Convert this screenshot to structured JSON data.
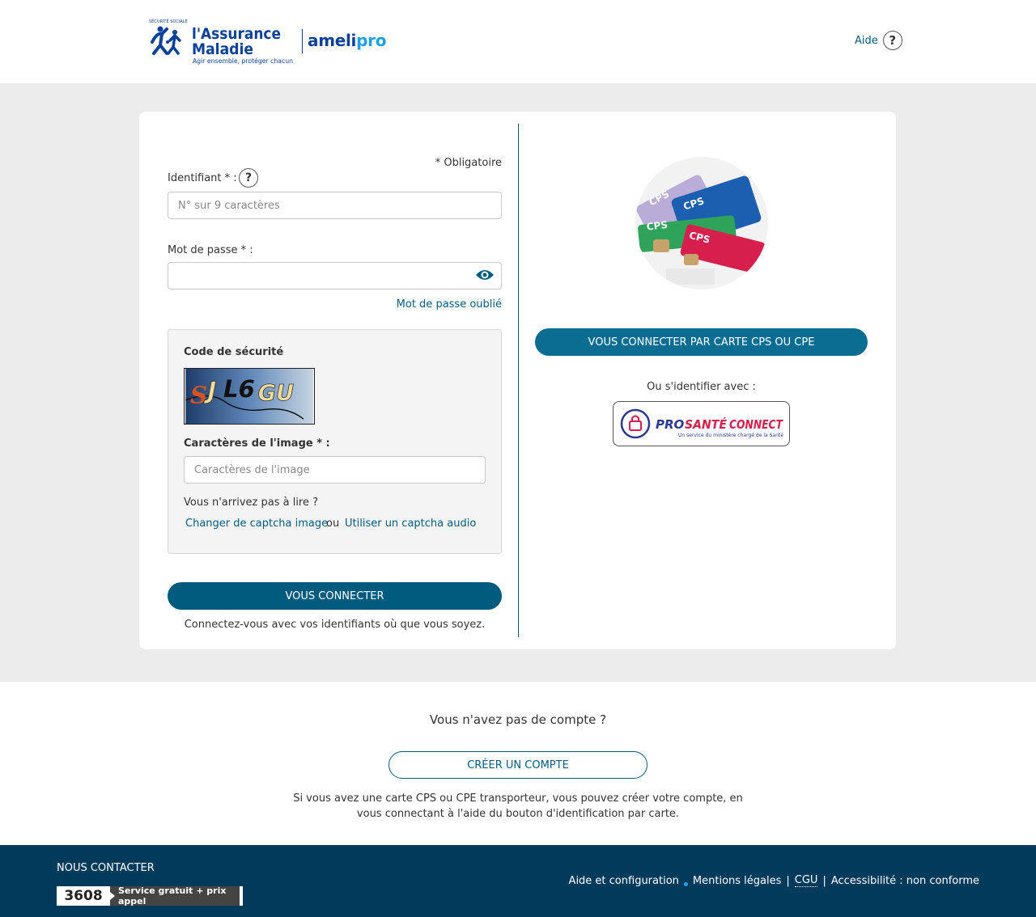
{
  "header": {
    "brand_name_line1": "l'Assurance",
    "brand_name_line2": "Maladie",
    "brand_tagline": "Agir ensemble, protéger chacun",
    "brand_arc_text": "SÉCURITÉ SOCIALE",
    "product_part1": "ameli",
    "product_part2": "pro",
    "help_label": "Aide",
    "help_icon": "question-circle-icon"
  },
  "login": {
    "required_note": "* Obligatoire",
    "identifier_label": "Identifiant * :",
    "identifier_placeholder": "N° sur 9 caractères",
    "identifier_value": "",
    "password_label": "Mot de passe * :",
    "password_value": "",
    "show_password_icon": "eye-icon",
    "forgot_password": "Mot de passe oublié",
    "captcha": {
      "title": "Code de sécurité",
      "image_text": "SJL6GU",
      "input_label": "Caractères de l'image * :",
      "input_placeholder": "Caractères de l'image",
      "input_value": "",
      "cannot_read": "Vous n'arrivez pas à lire ?",
      "change_image": "Changer de captcha image",
      "or": "ou",
      "audio": "Utiliser un captcha audio"
    },
    "submit": "VOUS CONNECTER",
    "submit_hint": "Connectez-vous avec vos identifiants où que vous soyez."
  },
  "card_login": {
    "card_image_label": "CPS",
    "cps_button": "VOUS CONNECTER PAR CARTE CPS OU CPE",
    "or_identify": "Ou s'identifier avec :",
    "psc_pro": "PRO",
    "psc_sante": "SANTÉ",
    "psc_connect": "CONNECT",
    "psc_sub": "Un service du ministère chargé de la Santé"
  },
  "no_account": {
    "title": "Vous n'avez pas de compte ?",
    "create_button": "CRÉER UN COMPTE",
    "text": "Si vous avez une carte CPS ou CPE transporteur, vous pouvez créer votre compte, en vous connectant à l'aide du bouton d'identification par carte."
  },
  "footer": {
    "contact": "NOUS CONTACTER",
    "phone": "3608",
    "phone_note": "Service gratuit + prix appel",
    "links": {
      "help": "Aide et configuration",
      "legal": "Mentions légales",
      "sep": "|",
      "cgu": "CGU",
      "accessibility": "Accessibilité : non conforme"
    }
  },
  "colors": {
    "primary": "#005b7f",
    "cps_button": "#0a6d91",
    "brand_blue": "#0c419a",
    "brand_light": "#1ea0e6",
    "footer_bg": "#003b5c",
    "band_bg": "#ececec"
  }
}
